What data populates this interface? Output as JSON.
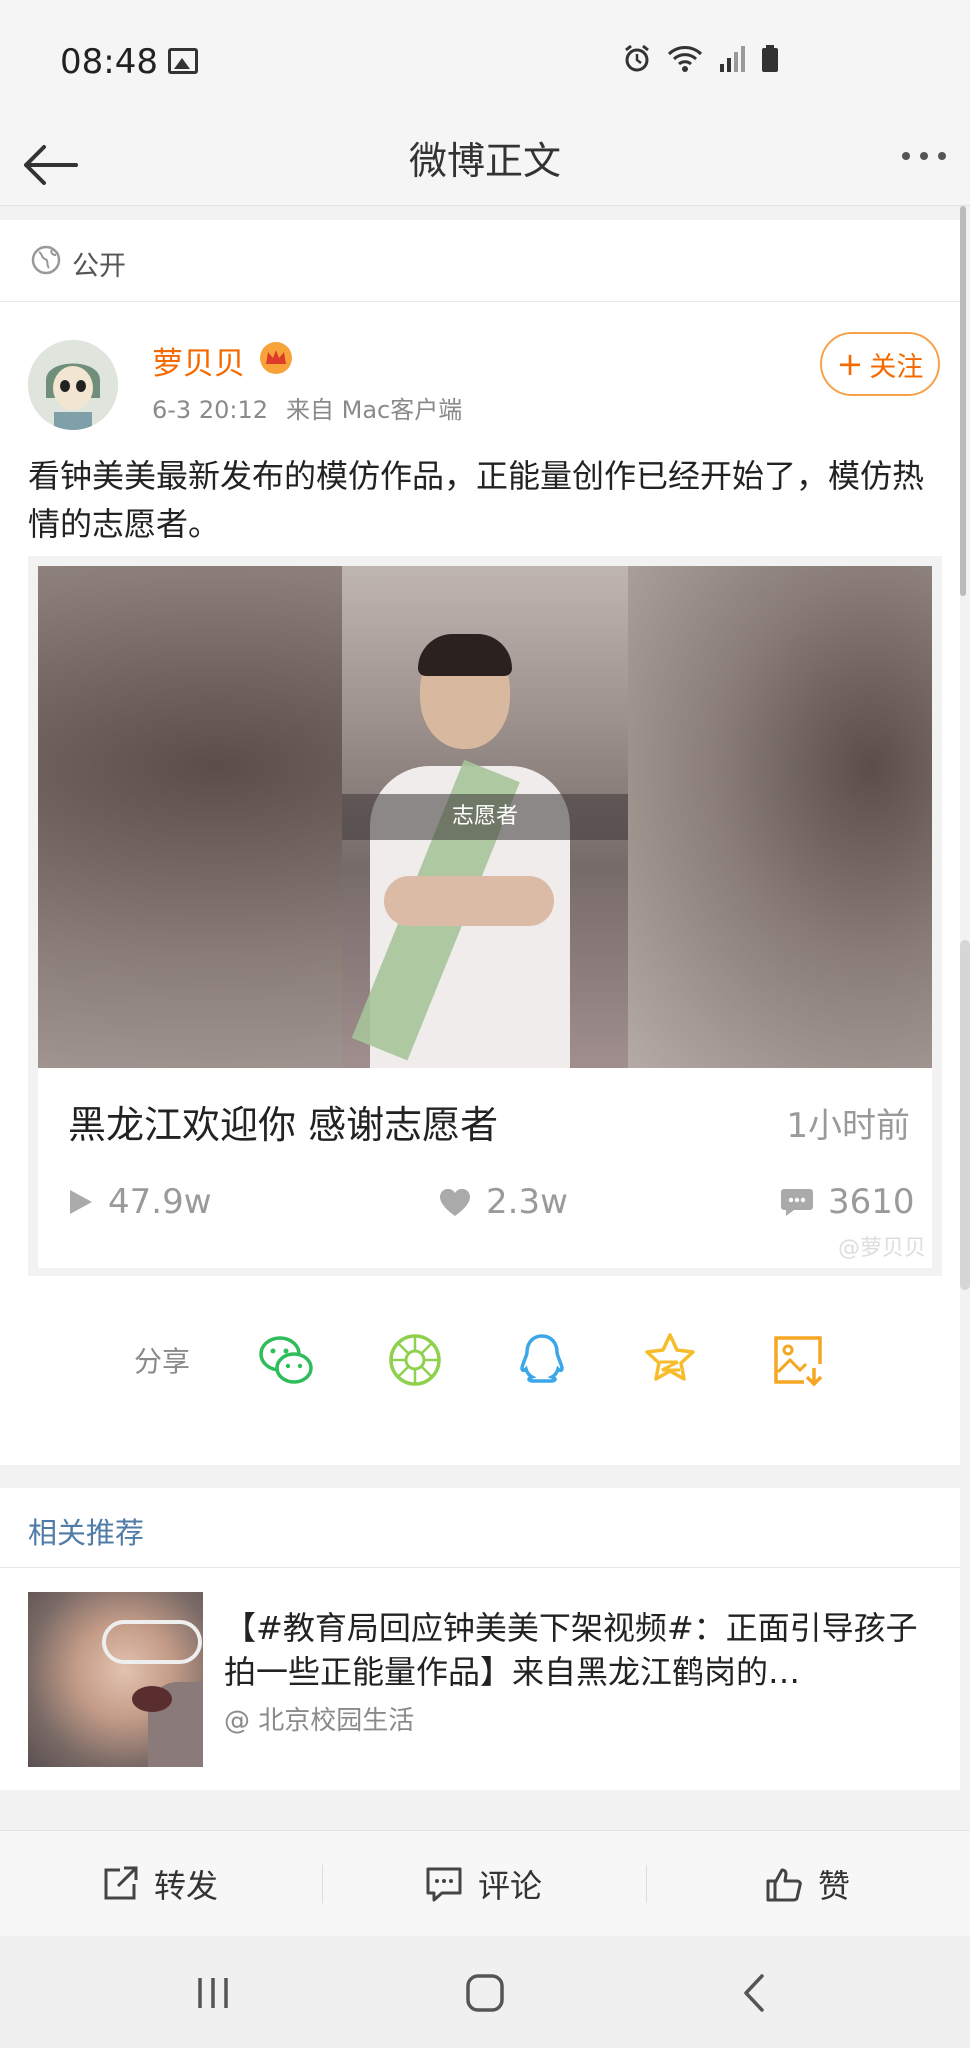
{
  "status_bar": {
    "time": "08:48",
    "icons": [
      "image-icon",
      "alarm-icon",
      "wifi-icon",
      "signal-icon",
      "battery-icon"
    ]
  },
  "nav": {
    "title": "微博正文",
    "back_icon": "back-arrow-icon",
    "more_icon": "more-dots-icon"
  },
  "post": {
    "visibility": "公开",
    "author": "萝贝贝",
    "date": "6-3 20:12",
    "source": "来自 Mac客户端",
    "follow_label": "关注",
    "follow_symbol": "+",
    "text": "看钟美美最新发布的模仿作品，正能量创作已经开始了，模仿热情的志愿者。",
    "accent_color": "#f56a00"
  },
  "video": {
    "caption": "志愿者",
    "title": "黑龙江欢迎你 感谢志愿者",
    "time_ago": "1小时前",
    "plays": "47.9w",
    "likes": "2.3w",
    "comments": "3610",
    "watermark": "@萝贝贝"
  },
  "share": {
    "label": "分享",
    "targets": [
      "wechat-icon",
      "moments-icon",
      "qq-icon",
      "qzone-icon",
      "save-image-icon"
    ]
  },
  "related": {
    "heading": "相关推荐",
    "items": [
      {
        "title": "【#教育局回应钟美美下架视频#：正面引导孩子拍一些正能量作品】来自黑龙江鹤岗的…",
        "source": "@ 北京校园生活"
      }
    ]
  },
  "actions": {
    "repost": "转发",
    "comment": "评论",
    "like": "赞"
  },
  "system_nav": [
    "recent-apps-icon",
    "home-icon",
    "back-icon"
  ]
}
